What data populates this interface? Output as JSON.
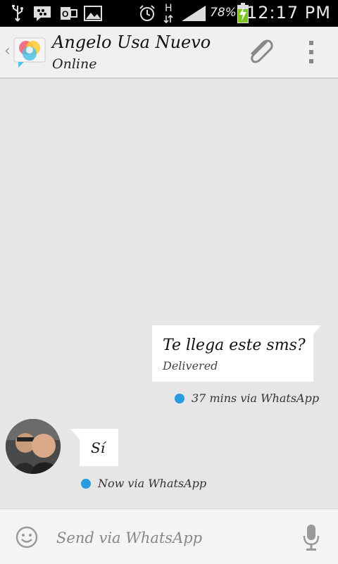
{
  "status_bar": {
    "battery_percent": "78%",
    "time": "12:17 PM",
    "network_label": "H"
  },
  "header": {
    "contact_name": "Angelo Usa Nuevo",
    "status": "Online"
  },
  "messages": [
    {
      "direction": "outgoing",
      "text": "Te llega este sms?",
      "delivery_status": "Delivered",
      "meta": "37 mins via WhatsApp"
    },
    {
      "direction": "incoming",
      "text": "Sí",
      "meta": "Now via WhatsApp"
    }
  ],
  "composer": {
    "placeholder": "Send via WhatsApp"
  },
  "colors": {
    "accent_dot": "#2a9be0",
    "background": "#e6e6e6"
  }
}
